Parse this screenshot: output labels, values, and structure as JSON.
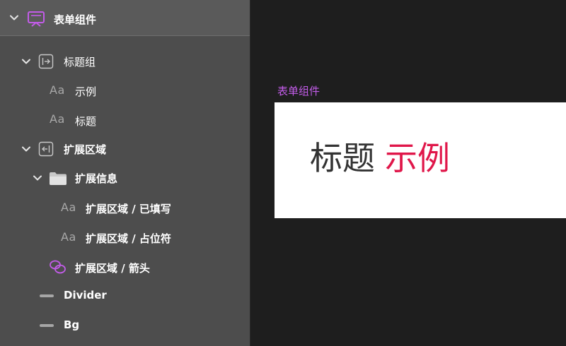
{
  "layers": {
    "root": {
      "label": "表单组件"
    },
    "items": [
      {
        "label": "标题组"
      },
      {
        "label": "示例",
        "glyph": "Aa"
      },
      {
        "label": "标题",
        "glyph": "Aa"
      },
      {
        "label": "扩展区域"
      },
      {
        "label": "扩展信息"
      },
      {
        "label": "扩展区域 / 已填写",
        "glyph": "Aa"
      },
      {
        "label": "扩展区域 / 占位符",
        "glyph": "Aa"
      },
      {
        "label": "扩展区域 / 箭头"
      },
      {
        "label": "Divider"
      },
      {
        "label": "Bg"
      }
    ]
  },
  "canvas": {
    "frame_label": "表单组件",
    "title_text": "标题",
    "example_text": "示例"
  },
  "colors": {
    "panel_bg": "#4d4d4d",
    "root_bg": "#5a5a5a",
    "canvas_bg": "#1e1e1e",
    "accent_purple": "#c25ce8",
    "example_red": "#e0174a"
  }
}
